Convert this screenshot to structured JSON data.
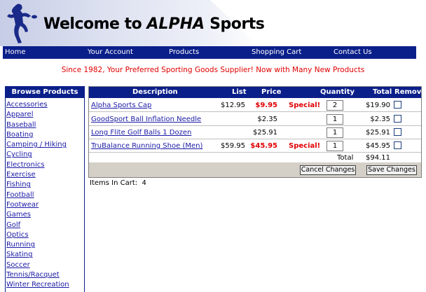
{
  "header": {
    "title_prefix": "Welcome to ",
    "title_brand": "ALPHA",
    "title_suffix": " Sports",
    "figure_icon": "discus-thrower-icon"
  },
  "nav": {
    "items": [
      {
        "label": "Home"
      },
      {
        "label": "Your Account"
      },
      {
        "label": "Products"
      },
      {
        "label": "Shopping Cart"
      },
      {
        "label": "Contact Us"
      }
    ]
  },
  "tagline": "Since 1982, Your Preferred Sporting Goods Supplier! Now with Many New Products",
  "sidebar": {
    "heading": "Browse Products",
    "items": [
      {
        "label": "Accessories"
      },
      {
        "label": "Apparel"
      },
      {
        "label": "Baseball"
      },
      {
        "label": "Boating"
      },
      {
        "label": "Camping / Hiking"
      },
      {
        "label": "Cycling"
      },
      {
        "label": "Electronics"
      },
      {
        "label": "Exercise"
      },
      {
        "label": "Fishing"
      },
      {
        "label": "Football"
      },
      {
        "label": "Footwear"
      },
      {
        "label": "Games"
      },
      {
        "label": "Golf"
      },
      {
        "label": "Optics"
      },
      {
        "label": "Running"
      },
      {
        "label": "Skating"
      },
      {
        "label": "Soccer"
      },
      {
        "label": "Tennis/Racquet"
      },
      {
        "label": "Winter Recreation"
      }
    ]
  },
  "cart": {
    "columns": {
      "description": "Description",
      "list": "List",
      "price": "Price",
      "quantity": "Quantity",
      "total": "Total",
      "remove": "Remove"
    },
    "rows": [
      {
        "description": "Alpha Sports Cap",
        "list": "$12.95",
        "price": "$9.95",
        "special": "Special!",
        "quantity": "2",
        "total": "$19.90"
      },
      {
        "description": "GoodSport Ball Inflation Needle",
        "list": "",
        "price": "$2.35",
        "special": "",
        "quantity": "1",
        "total": "$2.35"
      },
      {
        "description": "Long Flite Golf Balls 1 Dozen",
        "list": "",
        "price": "$25.91",
        "special": "",
        "quantity": "1",
        "total": "$25.91"
      },
      {
        "description": "TruBalance Running Shoe (Men)",
        "list": "$59.95",
        "price": "$45.95",
        "special": "Special!",
        "quantity": "1",
        "total": "$45.95"
      }
    ],
    "total_label": "Total",
    "total_value": "$94.11",
    "cancel_label": "Cancel Changes",
    "save_label": "Save Changes",
    "items_label": "Items In Cart:",
    "items_count": "4"
  },
  "colors": {
    "nav_bg": "#0b1f8a",
    "tagline": "#e00000",
    "link": "#1a1aa6",
    "special": "#e00000"
  }
}
